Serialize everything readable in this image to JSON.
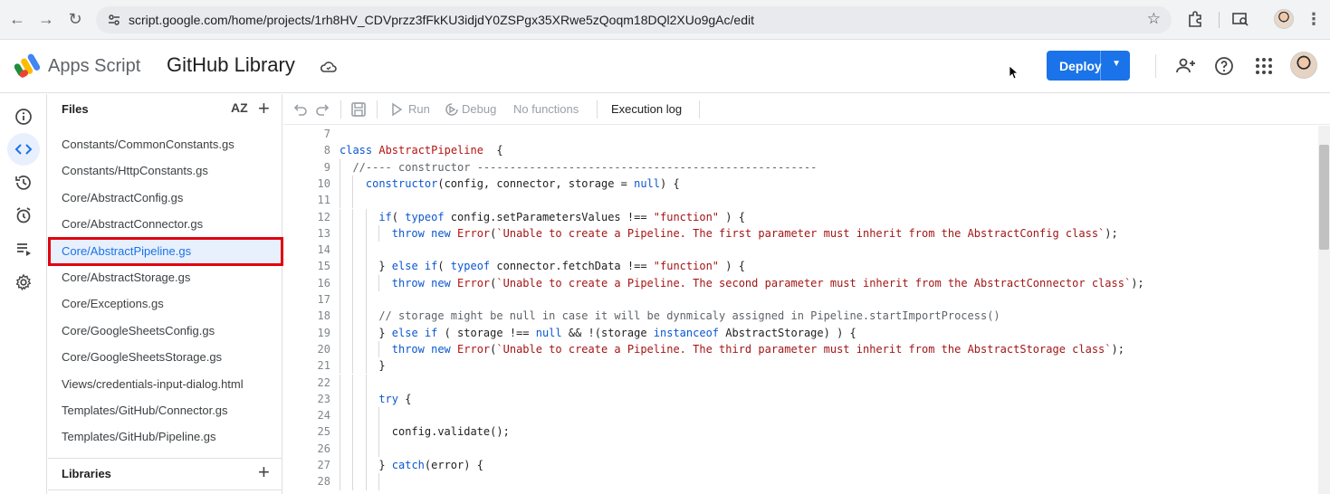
{
  "browser": {
    "url": "script.google.com/home/projects/1rh8HV_CDVprzz3fFkKU3idjdY0ZSPgx35XRwe5zQoqm18DQl2XUo9gAc/edit"
  },
  "app": {
    "product_name": "Apps Script",
    "project_title": "GitHub Library",
    "deploy_label": "Deploy"
  },
  "files_panel": {
    "header": "Files",
    "sort_label": "AZ",
    "libraries_header": "Libraries",
    "items": [
      {
        "label": "Constants/CommonConstants.gs"
      },
      {
        "label": "Constants/HttpConstants.gs"
      },
      {
        "label": "Core/AbstractConfig.gs"
      },
      {
        "label": "Core/AbstractConnector.gs"
      },
      {
        "label": "Core/AbstractPipeline.gs",
        "selected": true
      },
      {
        "label": "Core/AbstractStorage.gs"
      },
      {
        "label": "Core/Exceptions.gs"
      },
      {
        "label": "Core/GoogleSheetsConfig.gs"
      },
      {
        "label": "Core/GoogleSheetsStorage.gs"
      },
      {
        "label": "Views/credentials-input-dialog.html"
      },
      {
        "label": "Templates/GitHub/Connector.gs"
      },
      {
        "label": "Templates/GitHub/Pipeline.gs"
      }
    ]
  },
  "toolbar": {
    "run_label": "Run",
    "debug_label": "Debug",
    "function_select": "No functions",
    "execution_log_label": "Execution log"
  },
  "editor": {
    "lines": [
      {
        "n": "7",
        "indent": 0,
        "tokens": []
      },
      {
        "n": "8",
        "indent": 0,
        "tokens": [
          [
            "kw2",
            "class "
          ],
          [
            "cls",
            "AbstractPipeline"
          ],
          [
            "",
            "  {"
          ]
        ]
      },
      {
        "n": "9",
        "indent": 1,
        "tokens": [
          [
            "cm",
            "//---- constructor ----------------------------------------------------"
          ]
        ]
      },
      {
        "n": "10",
        "indent": 2,
        "tokens": [
          [
            "kw2",
            "constructor"
          ],
          [
            "",
            "(config, connector, storage = "
          ],
          [
            "null",
            "null"
          ],
          [
            "",
            ") {"
          ]
        ]
      },
      {
        "n": "11",
        "indent": 2,
        "tokens": []
      },
      {
        "n": "12",
        "indent": 3,
        "tokens": [
          [
            "kw2",
            "if"
          ],
          [
            "",
            "( "
          ],
          [
            "kw2",
            "typeof"
          ],
          [
            "",
            " config.setParametersValues !== "
          ],
          [
            "str",
            "\"function\""
          ],
          [
            "",
            " ) {"
          ]
        ]
      },
      {
        "n": "13",
        "indent": 4,
        "tokens": [
          [
            "kw2",
            "throw"
          ],
          [
            "",
            " "
          ],
          [
            "kw2",
            "new"
          ],
          [
            "",
            " "
          ],
          [
            "cls",
            "Error"
          ],
          [
            "",
            "("
          ],
          [
            "str",
            "`Unable to create a Pipeline. The first parameter must inherit from the AbstractConfig class`"
          ],
          [
            "",
            ");"
          ]
        ]
      },
      {
        "n": "14",
        "indent": 3,
        "tokens": []
      },
      {
        "n": "15",
        "indent": 3,
        "tokens": [
          [
            "",
            "} "
          ],
          [
            "kw2",
            "else if"
          ],
          [
            "",
            "( "
          ],
          [
            "kw2",
            "typeof"
          ],
          [
            "",
            " connector.fetchData !== "
          ],
          [
            "str",
            "\"function\""
          ],
          [
            "",
            " ) {"
          ]
        ]
      },
      {
        "n": "16",
        "indent": 4,
        "tokens": [
          [
            "kw2",
            "throw"
          ],
          [
            "",
            " "
          ],
          [
            "kw2",
            "new"
          ],
          [
            "",
            " "
          ],
          [
            "cls",
            "Error"
          ],
          [
            "",
            "("
          ],
          [
            "str",
            "`Unable to create a Pipeline. The second parameter must inherit from the AbstractConnector class`"
          ],
          [
            "",
            ");"
          ]
        ]
      },
      {
        "n": "17",
        "indent": 3,
        "tokens": []
      },
      {
        "n": "18",
        "indent": 3,
        "tokens": [
          [
            "cm",
            "// storage might be null in case it will be dynmicaly assigned in Pipeline.startImportProcess()"
          ]
        ]
      },
      {
        "n": "19",
        "indent": 3,
        "tokens": [
          [
            "",
            "} "
          ],
          [
            "kw2",
            "else if"
          ],
          [
            "",
            " ( storage !== "
          ],
          [
            "null",
            "null"
          ],
          [
            "",
            " && !(storage "
          ],
          [
            "kw2",
            "instanceof"
          ],
          [
            "",
            " AbstractStorage) ) {"
          ]
        ]
      },
      {
        "n": "20",
        "indent": 4,
        "tokens": [
          [
            "kw2",
            "throw"
          ],
          [
            "",
            " "
          ],
          [
            "kw2",
            "new"
          ],
          [
            "",
            " "
          ],
          [
            "cls",
            "Error"
          ],
          [
            "",
            "("
          ],
          [
            "str",
            "`Unable to create a Pipeline. The third parameter must inherit from the AbstractStorage class`"
          ],
          [
            "",
            ");"
          ]
        ]
      },
      {
        "n": "21",
        "indent": 3,
        "tokens": [
          [
            "",
            "}"
          ]
        ]
      },
      {
        "n": "22",
        "indent": 3,
        "tokens": []
      },
      {
        "n": "23",
        "indent": 3,
        "tokens": [
          [
            "kw2",
            "try"
          ],
          [
            "",
            " {"
          ]
        ]
      },
      {
        "n": "24",
        "indent": 4,
        "tokens": []
      },
      {
        "n": "25",
        "indent": 4,
        "tokens": [
          [
            "",
            "config.validate();"
          ]
        ]
      },
      {
        "n": "26",
        "indent": 4,
        "tokens": []
      },
      {
        "n": "27",
        "indent": 3,
        "tokens": [
          [
            "",
            "} "
          ],
          [
            "kw2",
            "catch"
          ],
          [
            "",
            "(error) {"
          ]
        ]
      },
      {
        "n": "28",
        "indent": 4,
        "tokens": []
      }
    ]
  }
}
